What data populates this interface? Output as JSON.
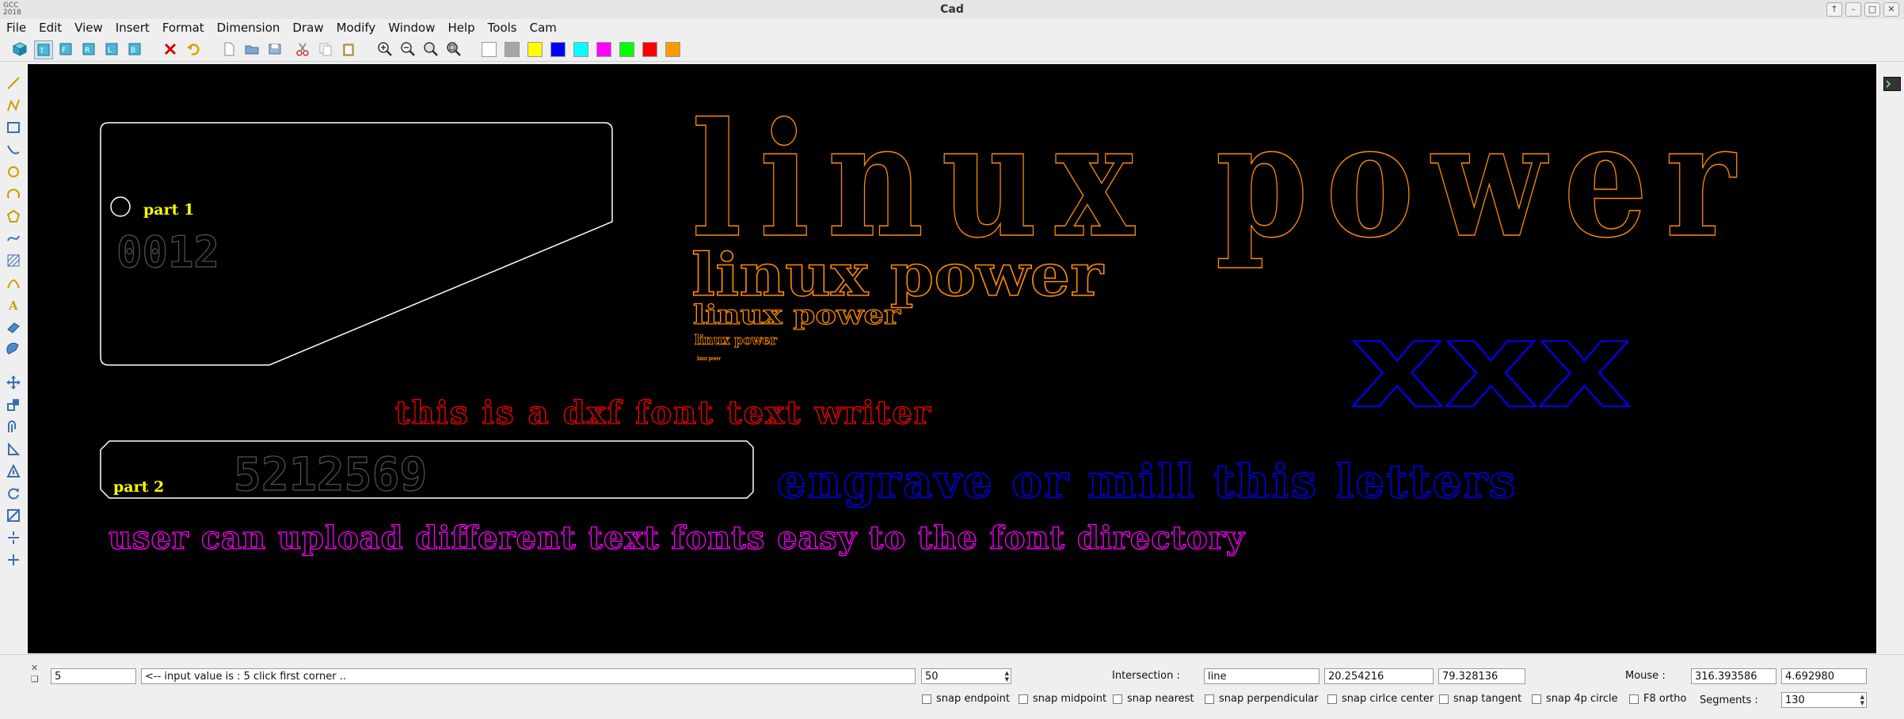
{
  "window": {
    "title": "Cad",
    "logo_line1": "GCC",
    "logo_line2": "2018"
  },
  "menu": [
    "File",
    "Edit",
    "View",
    "Insert",
    "Format",
    "Dimension",
    "Draw",
    "Modify",
    "Window",
    "Help",
    "Tools",
    "Cam"
  ],
  "colors": {
    "swatches": [
      "#ffffff",
      "#a6a6a6",
      "#ffff00",
      "#0000ff",
      "#00ffff",
      "#ff00ff",
      "#00ff00",
      "#ff0000",
      "#ff9900"
    ],
    "canvas_bg": "#000000"
  },
  "canvas": {
    "part1_label": "part 1",
    "part1_number": "0012",
    "part2_label": "part 2",
    "part2_number": "5212569",
    "big_title": "linux power",
    "medium_title": "linux power",
    "small_title": "linux power",
    "tiny_title": "linux power",
    "micro_title": "linux power",
    "xxx_text": "xxx",
    "red_text": "this is a dxf font text writer",
    "blue_text": "engrave or mill this letters",
    "magenta_text": "user can upload different text fonts easy to the font directory"
  },
  "statusbar": {
    "command_value": "5",
    "message": "<-- input value is : 5 click first corner ..",
    "step_value": "50",
    "intersection_label": "Intersection :",
    "intersection_type": "line",
    "intersection_x": "20.254216",
    "intersection_y": "79.328136",
    "mouse_label": "Mouse :",
    "mouse_x": "316.393586",
    "mouse_y": "4.692980",
    "segments_label": "Segments :",
    "segments_value": "130",
    "snaps": [
      "snap endpoint",
      "snap midpoint",
      "snap nearest",
      "snap perpendicular",
      "snap cirlce center",
      "snap tangent",
      "snap 4p circle",
      "F8 ortho"
    ]
  }
}
